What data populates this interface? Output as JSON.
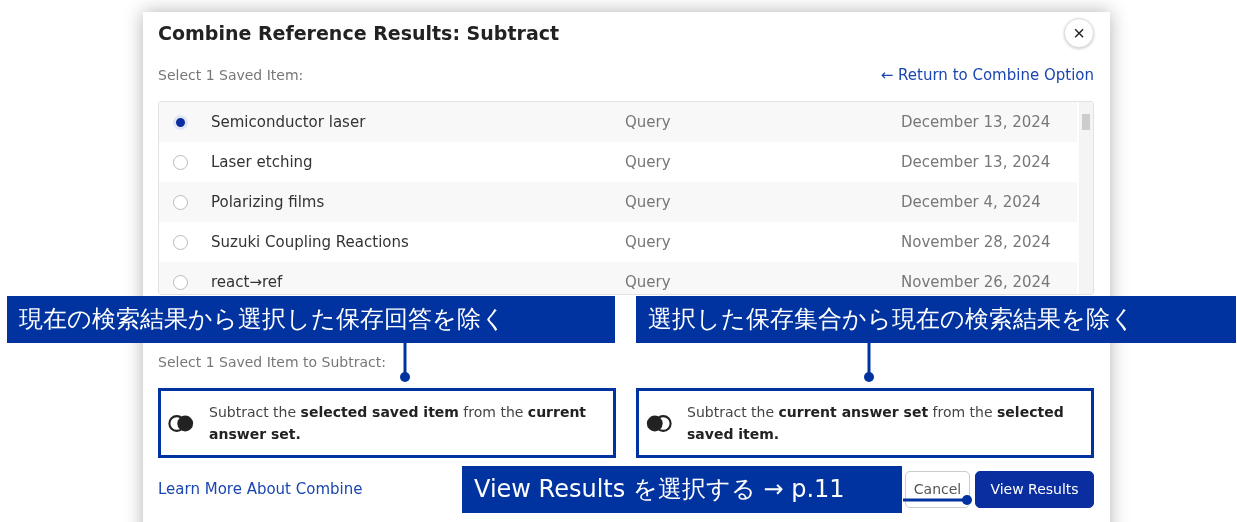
{
  "dialog": {
    "title": "Combine Reference Results: Subtract",
    "close": "×",
    "section_label": "Select 1 Saved Item:",
    "return_link": "← Return to Combine Option",
    "items": [
      {
        "name": "Semiconductor laser",
        "type": "Query",
        "date": "December 13, 2024",
        "selected": true
      },
      {
        "name": "Laser etching",
        "type": "Query",
        "date": "December 13, 2024",
        "selected": false
      },
      {
        "name": "Polarizing films",
        "type": "Query",
        "date": "December 4, 2024",
        "selected": false
      },
      {
        "name": "Suzuki Coupling Reactions",
        "type": "Query",
        "date": "November 28, 2024",
        "selected": false
      },
      {
        "name": "react→ref",
        "type": "Query",
        "date": "November 26, 2024",
        "selected": false
      }
    ],
    "subtract_label": "Select 1 Saved Item to Subtract:",
    "options": [
      {
        "kind": "saved-from-current",
        "text": "Subtract the **selected saved item** from the **current answer set.**"
      },
      {
        "kind": "current-from-saved",
        "text": "Subtract the **current answer set** from the **selected saved item.**"
      }
    ],
    "learn_more_link": "Learn More About Combine",
    "buttons": [
      {
        "label": "Cancel",
        "kind": "secondary"
      },
      {
        "label": "View Results",
        "kind": "primary"
      }
    ]
  },
  "annotations": [
    {
      "text": "現在の検索結果から選択した保存回答を除く"
    },
    {
      "text": "選択した保存集合から現在の検索結果を除く"
    },
    {
      "text": "View Results を選択する → p.11"
    }
  ]
}
